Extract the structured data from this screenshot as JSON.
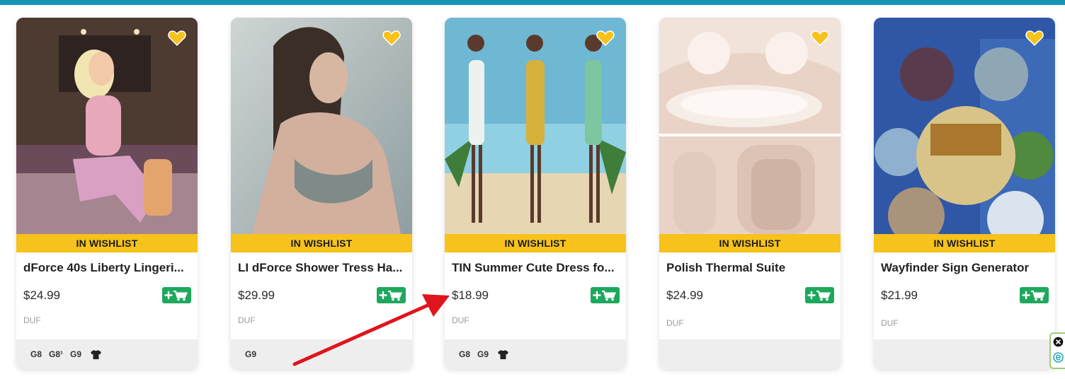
{
  "colors": {
    "accent_bar": "#1595b3",
    "wishlist_band": "#f6c21b",
    "heart": "#f6c21b",
    "cart_button": "#1ea85d",
    "annotation_arrow": "#e0141c"
  },
  "products": [
    {
      "wishlist_label": "IN WISHLIST",
      "name": "dForce 40s Liberty Lingeri...",
      "price": "$24.99",
      "format": "DUF",
      "tags": [
        "G8",
        "G8¹",
        "G9"
      ],
      "clothing_icon": true,
      "icons": [
        "heart-icon",
        "add-to-cart-icon",
        "shirt-icon"
      ]
    },
    {
      "wishlist_label": "IN WISHLIST",
      "name": "LI dForce Shower Tress Ha...",
      "price": "$29.99",
      "format": "DUF",
      "tags": [
        "G9"
      ],
      "clothing_icon": false,
      "icons": [
        "heart-icon",
        "add-to-cart-icon"
      ]
    },
    {
      "wishlist_label": "IN WISHLIST",
      "name": "TIN Summer Cute Dress fo...",
      "price": "$18.99",
      "format": "DUF",
      "tags": [
        "G8",
        "G9"
      ],
      "clothing_icon": true,
      "icons": [
        "heart-icon",
        "add-to-cart-icon",
        "shirt-icon"
      ]
    },
    {
      "wishlist_label": "IN WISHLIST",
      "name": "Polish Thermal Suite",
      "price": "$24.99",
      "format": "DUF",
      "tags": [],
      "clothing_icon": false,
      "icons": [
        "heart-icon",
        "add-to-cart-icon"
      ]
    },
    {
      "wishlist_label": "IN WISHLIST",
      "name": "Wayfinder Sign Generator",
      "price": "$21.99",
      "format": "DUF",
      "tags": [],
      "clothing_icon": false,
      "icons": [
        "heart-icon",
        "add-to-cart-icon"
      ]
    }
  ],
  "side_widget": {
    "icons": [
      "close-icon",
      "e-icon"
    ]
  }
}
